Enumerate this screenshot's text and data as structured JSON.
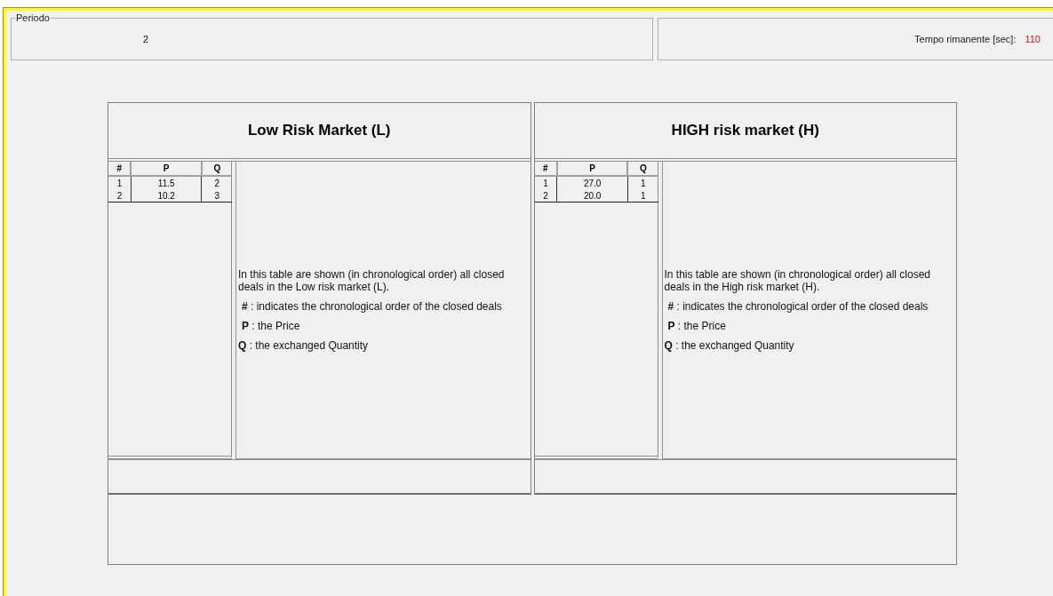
{
  "period": {
    "label": "Periodo",
    "value": "2"
  },
  "timer": {
    "label": "Tempo rimanente [sec]:",
    "value": "110"
  },
  "markets": [
    {
      "title": "Low Risk Market (L)",
      "columns": [
        "#",
        "P",
        "Q"
      ],
      "rows": [
        [
          "1",
          "11.5",
          "2"
        ],
        [
          "2",
          "10.2",
          "3"
        ]
      ],
      "description": [
        "In this table are shown (in chronological order) all closed deals in the Low risk market (L).",
        "**#** : indicates the chronological order of the closed deals",
        "**P** : the Price",
        "**Q** : the exchanged Quantity"
      ]
    },
    {
      "title": "HIGH risk market (H)",
      "columns": [
        "#",
        "P",
        "Q"
      ],
      "rows": [
        [
          "1",
          "27.0",
          "1"
        ],
        [
          "2",
          "20.0",
          "1"
        ]
      ],
      "description": [
        "In this table are shown (in chronological order) all closed deals in the High risk market (H).",
        "**#** : indicates the chronological order of the closed deals",
        "**P** : the Price",
        "**Q** : the exchanged Quantity"
      ]
    }
  ]
}
